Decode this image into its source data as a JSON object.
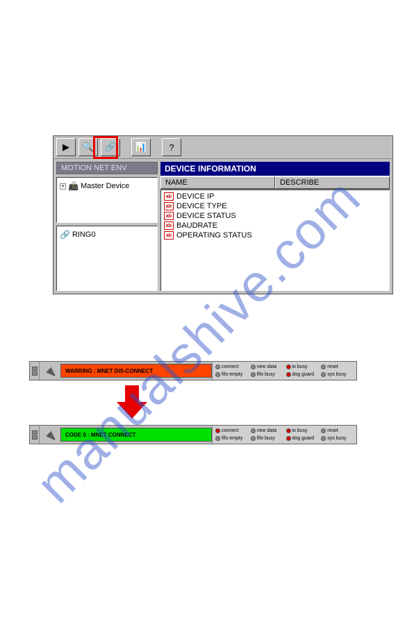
{
  "watermark": "manualshive.com",
  "toolbar": {
    "buttons": [
      {
        "name": "run-icon",
        "glyph": "▶"
      },
      {
        "name": "zoom-icon",
        "glyph": "🔍"
      },
      {
        "name": "connect-icon",
        "glyph": "🔗"
      },
      {
        "name": "config-icon",
        "glyph": "📊"
      },
      {
        "name": "help-icon",
        "glyph": "?"
      }
    ]
  },
  "tree": {
    "title": "MOTION NET ENV",
    "root": {
      "label": "Master Device",
      "expander": "+"
    },
    "ring": {
      "label": "RING0"
    }
  },
  "device_info": {
    "title": "DEVICE INFORMATION",
    "columns": [
      "NAME",
      "DESCRIBE"
    ],
    "rows": [
      "DEVICE IP",
      "DEVICE TYPE",
      "DEVICE STATUS",
      "BAUDRATE",
      "OPERATING STATUS"
    ],
    "ab_text": "ab"
  },
  "status_before": {
    "message": "WARRING : MNET DIS-CONNECT",
    "kind": "warn",
    "leds": [
      {
        "label": "connect",
        "state": "off"
      },
      {
        "label": "new data",
        "state": "off"
      },
      {
        "label": "io busy",
        "state": "red"
      },
      {
        "label": "reset",
        "state": "off"
      },
      {
        "label": "fifo empty",
        "state": "off"
      },
      {
        "label": "fifo busy",
        "state": "off"
      },
      {
        "label": "dog guard",
        "state": "red"
      },
      {
        "label": "sys busy",
        "state": "off"
      }
    ]
  },
  "status_after": {
    "message": "CODE 0 : MNET CONNECT",
    "kind": "ok",
    "leds": [
      {
        "label": "connect",
        "state": "red"
      },
      {
        "label": "new data",
        "state": "off"
      },
      {
        "label": "io busy",
        "state": "red"
      },
      {
        "label": "reset",
        "state": "off"
      },
      {
        "label": "fifo empty",
        "state": "off"
      },
      {
        "label": "fifo busy",
        "state": "off"
      },
      {
        "label": "dog guard",
        "state": "red"
      },
      {
        "label": "sys busy",
        "state": "off"
      }
    ]
  }
}
